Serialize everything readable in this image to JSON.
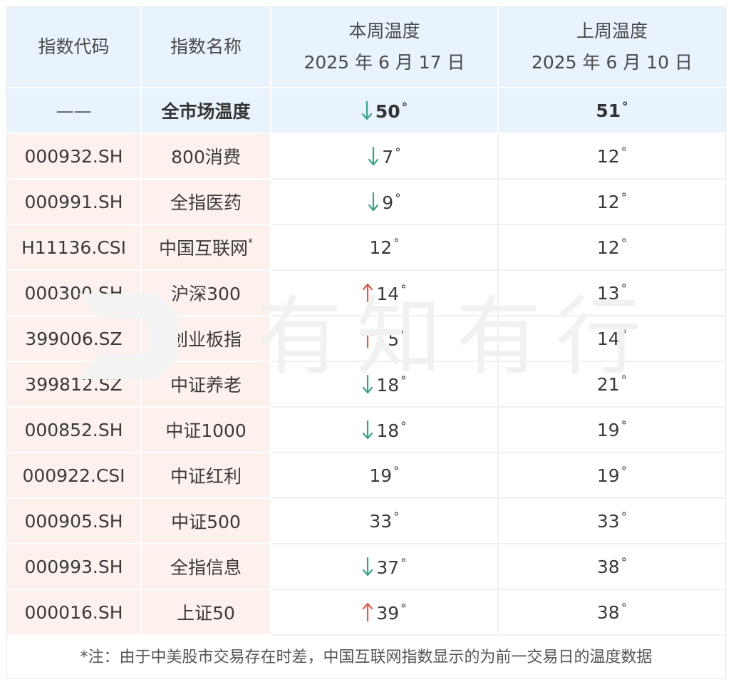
{
  "header": {
    "col_code": "指数代码",
    "col_name": "指数名称",
    "col_current_title": "本周温度",
    "col_current_date": "2025 年 6 月 17 日",
    "col_previous_title": "上周温度",
    "col_previous_date": "2025 年 6 月 10 日"
  },
  "market": {
    "code": "——",
    "name": "全市场温度",
    "current": "50",
    "previous": "51",
    "trend": "down"
  },
  "rows": [
    {
      "code": "000932.SH",
      "name": "800消费",
      "current": "7",
      "previous": "12",
      "trend": "down"
    },
    {
      "code": "000991.SH",
      "name": "全指医药",
      "current": "9",
      "previous": "12",
      "trend": "down"
    },
    {
      "code": "H11136.CSI",
      "name": "中国互联网",
      "name_sup": "*",
      "current": "12",
      "previous": "12",
      "trend": "none"
    },
    {
      "code": "000300.SH",
      "name": "沪深300",
      "current": "14",
      "previous": "13",
      "trend": "up"
    },
    {
      "code": "399006.SZ",
      "name": "创业板指",
      "current": "15",
      "previous": "14",
      "trend": "up"
    },
    {
      "code": "399812.SZ",
      "name": "中证养老",
      "current": "18",
      "previous": "21",
      "trend": "down"
    },
    {
      "code": "000852.SH",
      "name": "中证1000",
      "current": "18",
      "previous": "19",
      "trend": "down"
    },
    {
      "code": "000922.CSI",
      "name": "中证红利",
      "current": "19",
      "previous": "19",
      "trend": "none"
    },
    {
      "code": "000905.SH",
      "name": "中证500",
      "current": "33",
      "previous": "33",
      "trend": "none"
    },
    {
      "code": "000993.SH",
      "name": "全指信息",
      "current": "37",
      "previous": "38",
      "trend": "down"
    },
    {
      "code": "000016.SH",
      "name": "上证50",
      "current": "39",
      "previous": "38",
      "trend": "up"
    }
  ],
  "degree_symbol": "°",
  "note": "*注：由于中美股市交易存在时差，中国互联网指数显示的为前一交易日的温度数据",
  "watermark": "有知有行",
  "colors": {
    "up": "#e05a4f",
    "down": "#3aa28c",
    "header_bg": "#e9f3fd",
    "left_col_bg": "#fdf1ee"
  },
  "icons": {
    "up": "arrow-up-icon",
    "down": "arrow-down-icon"
  }
}
